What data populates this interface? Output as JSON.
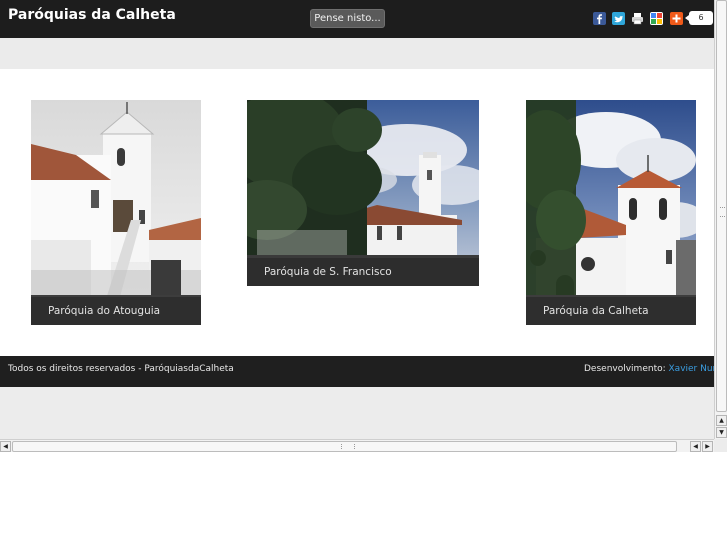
{
  "header": {
    "title": "Paróquias da Calheta",
    "pense_button": "Pense nisto...",
    "share_icons": [
      "facebook-icon",
      "twitter-icon",
      "print-icon",
      "google-bookmark-icon",
      "addthis-icon"
    ],
    "share_count": "6"
  },
  "gallery": {
    "items": [
      {
        "caption": "Paróquia do Atouguia"
      },
      {
        "caption": "Paróquia de S. Francisco"
      },
      {
        "caption": "Paróquia da Calheta"
      }
    ]
  },
  "footer": {
    "copyright": "Todos os direitos reservados - ParóquiasdaCalheta",
    "dev_label": "Desenvolvimento:",
    "dev_name": "Xavier Nunes"
  },
  "colors": {
    "topbar": "#1d1d1d",
    "footer": "#1f1f1f",
    "link": "#3a9de0",
    "facebook": "#3b5998",
    "twitter": "#2fa6d9",
    "addthis": "#f05a1a"
  }
}
